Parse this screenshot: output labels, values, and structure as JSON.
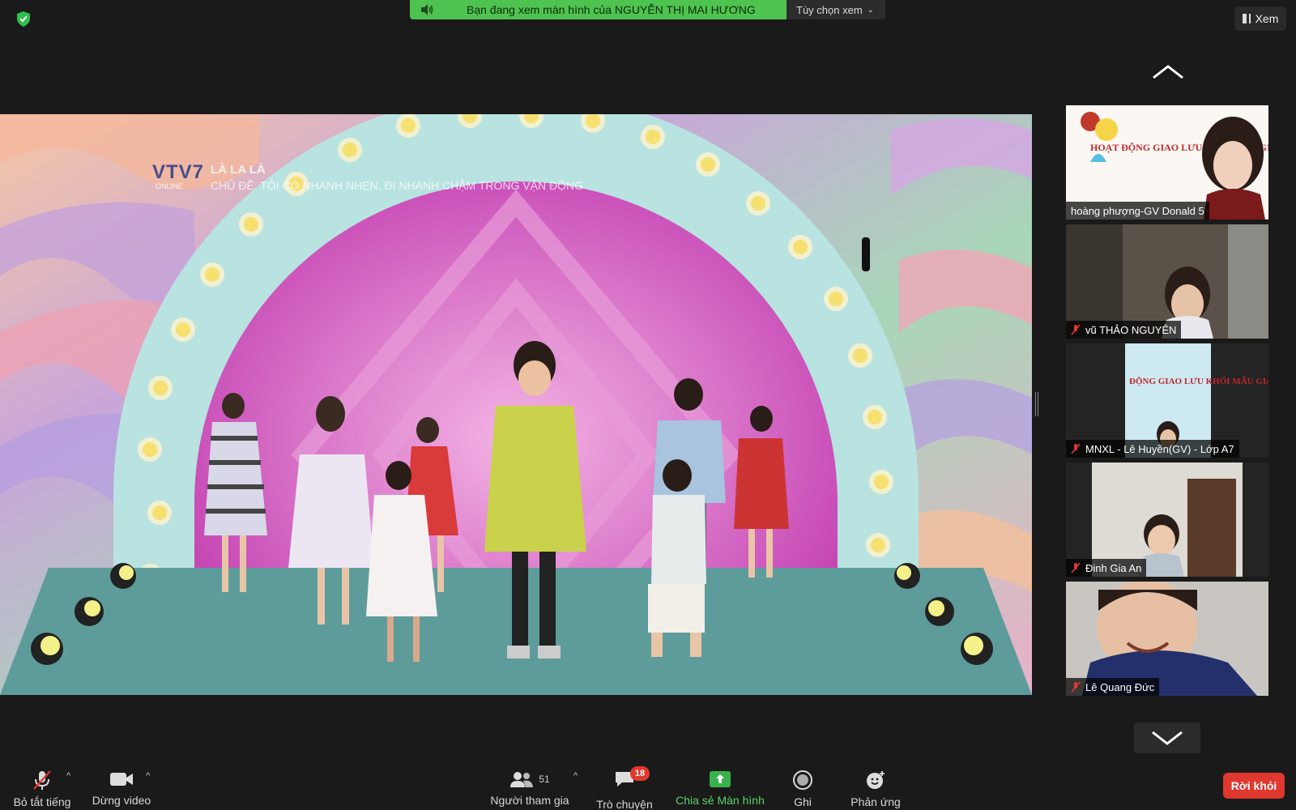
{
  "banner": {
    "viewing_text": "Bạn đang xem màn hình của NGUYỄN THỊ MAI HƯƠNG",
    "view_options_label": "Tùy chọn xem"
  },
  "view_button_label": "Xem",
  "shared_screen": {
    "logo": "VTV7",
    "logo_sub": "ONLINE",
    "show_title": "LÀ LA LÁ",
    "show_theme": "CHỦ ĐỀ: TÔI CÓ NHANH NHẸN, ĐI NHANH CHẬM TRONG VẬN ĐỘNG"
  },
  "gallery": {
    "participants": [
      {
        "name": "hoàng phượng-GV Donald 5",
        "muted": false,
        "slide_text": "HOẠT ĐỘNG GIAO LƯU KHỐI MẪU GIÁO"
      },
      {
        "name": "vũ THẢO NGUYÊN",
        "muted": true
      },
      {
        "name": "MNXL - Lê Huyền(GV) - Lớp A7",
        "muted": true,
        "slide_text": "ĐỘNG GIAO LƯU KHỐI MẪU GIÁO L"
      },
      {
        "name": "Đinh Gia An",
        "muted": true
      },
      {
        "name": "Lê Quang Đức",
        "muted": true
      }
    ]
  },
  "toolbar": {
    "mute_label": "Bỏ tắt tiếng",
    "video_label": "Dừng video",
    "participants_label": "Người tham gia",
    "participants_count": "51",
    "chat_label": "Trò chuyện",
    "chat_badge": "18",
    "share_label": "Chia sẻ Màn hình",
    "record_label": "Ghi",
    "reactions_label": "Phản ứng",
    "leave_label": "Rời khỏi"
  },
  "colors": {
    "accent_green": "#4fc34f",
    "leave_red": "#e0382f",
    "background": "#1a1a1a"
  }
}
